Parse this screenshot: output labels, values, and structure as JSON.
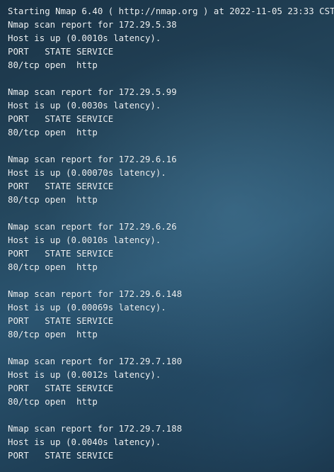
{
  "terminal": {
    "lines": [
      "Starting Nmap 6.40 ( http://nmap.org ) at 2022-11-05 23:33 CST",
      "Nmap scan report for 172.29.5.38",
      "Host is up (0.0010s latency).",
      "PORT   STATE SERVICE",
      "80/tcp open  http",
      "",
      "Nmap scan report for 172.29.5.99",
      "Host is up (0.0030s latency).",
      "PORT   STATE SERVICE",
      "80/tcp open  http",
      "",
      "Nmap scan report for 172.29.6.16",
      "Host is up (0.00070s latency).",
      "PORT   STATE SERVICE",
      "80/tcp open  http",
      "",
      "Nmap scan report for 172.29.6.26",
      "Host is up (0.0010s latency).",
      "PORT   STATE SERVICE",
      "80/tcp open  http",
      "",
      "Nmap scan report for 172.29.6.148",
      "Host is up (0.00069s latency).",
      "PORT   STATE SERVICE",
      "80/tcp open  http",
      "",
      "Nmap scan report for 172.29.7.180",
      "Host is up (0.0012s latency).",
      "PORT   STATE SERVICE",
      "80/tcp open  http",
      "",
      "Nmap scan report for 172.29.7.188",
      "Host is up (0.0040s latency).",
      "PORT   STATE SERVICE"
    ]
  }
}
